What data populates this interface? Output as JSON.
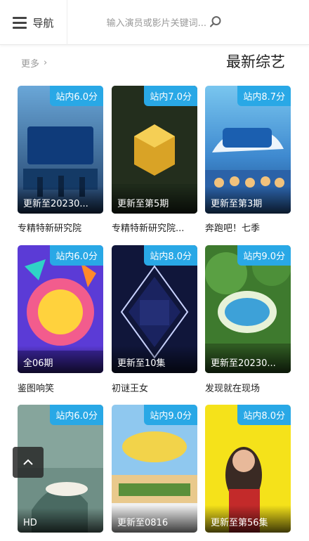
{
  "header": {
    "nav_label": "导航",
    "search_placeholder": "输入演员或影片关键词..."
  },
  "section": {
    "title": "最新综艺",
    "more_label": "更多"
  },
  "items": [
    {
      "title": "奔跑吧！七季",
      "score": "站内8.7分",
      "status": "更新至第3期"
    },
    {
      "title": "专精特新研究院...",
      "score": "站内7.0分",
      "status": "更新至第5期"
    },
    {
      "title": "专精特新研究院",
      "score": "站内6.0分",
      "status": "更新至20230..."
    },
    {
      "title": "发现就在现场",
      "score": "站内9.0分",
      "status": "更新至20230..."
    },
    {
      "title": "初谜王女",
      "score": "站内8.0分",
      "status": "更新至10集"
    },
    {
      "title": "鉴图响笑",
      "score": "站内6.0分",
      "status": "全06期"
    },
    {
      "title": "",
      "score": "站内8.0分",
      "status": "更新至第56集"
    },
    {
      "title": "",
      "score": "站内9.0分",
      "status": "更新至0816"
    },
    {
      "title": "",
      "score": "站内6.0分",
      "status": "HD"
    }
  ],
  "colors": {
    "score_badge": "#29a8e6"
  }
}
